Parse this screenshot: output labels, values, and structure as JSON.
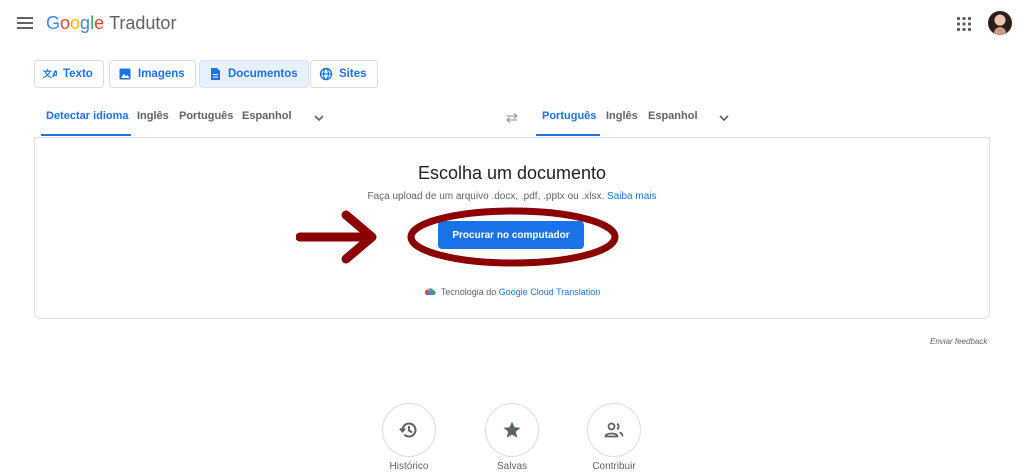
{
  "header": {
    "logo_letters": [
      "G",
      "o",
      "o",
      "g",
      "l",
      "e"
    ],
    "product": "Tradutor"
  },
  "modes": [
    {
      "label": "Texto",
      "icon": "translate-icon",
      "active": false
    },
    {
      "label": "Imagens",
      "icon": "image-icon",
      "active": false
    },
    {
      "label": "Documentos",
      "icon": "document-icon",
      "active": true
    },
    {
      "label": "Sites",
      "icon": "globe-icon",
      "active": false
    }
  ],
  "source_langs": [
    "Detectar idioma",
    "Inglês",
    "Português",
    "Espanhol"
  ],
  "target_langs": [
    "Português",
    "Inglês",
    "Espanhol"
  ],
  "card": {
    "title": "Escolha um documento",
    "subtitle_prefix": "Faça upload de um arquivo .docx, .pdf, .pptx ou .xlsx.",
    "learn_more": "Saiba mais",
    "upload_button": "Procurar no computador",
    "powered_prefix": "Tecnologia do",
    "powered_link": "Google Cloud Translation"
  },
  "feedback": "Enviar feedback",
  "bottom_buttons": [
    {
      "label": "Histórico",
      "icon": "history-icon"
    },
    {
      "label": "Salvas",
      "icon": "star-icon"
    },
    {
      "label": "Contribuir",
      "icon": "community-icon"
    }
  ],
  "colors": {
    "accent": "#1a73e8",
    "annotation": "#8b0000"
  }
}
